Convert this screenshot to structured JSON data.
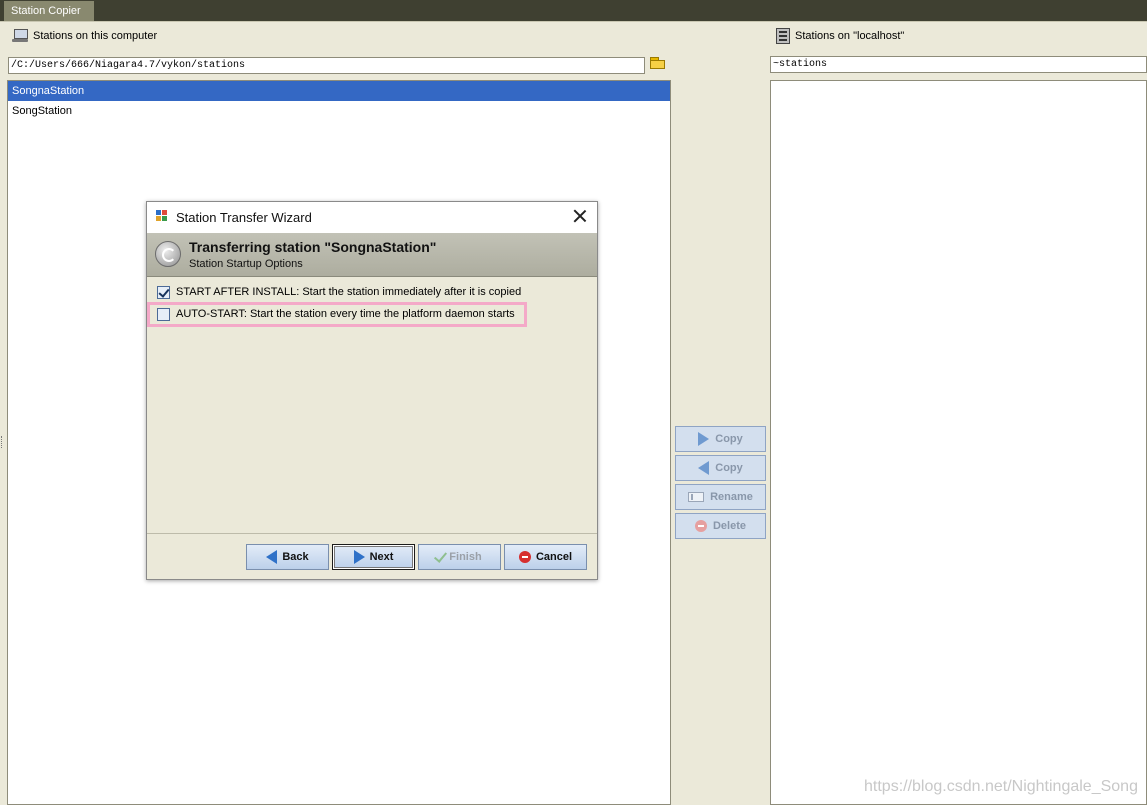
{
  "window": {
    "tab_label": "Station Copier"
  },
  "left_panel": {
    "label": "Stations on this computer",
    "path": "/C:/Users/666/Niagara4.7/vykon/stations",
    "items": [
      {
        "label": "SongnaStation",
        "selected": true
      },
      {
        "label": "SongStation",
        "selected": false
      }
    ]
  },
  "right_panel": {
    "label": "Stations on \"localhost\"",
    "path": "~stations"
  },
  "side_buttons": {
    "copy_right": "Copy",
    "copy_left": "Copy",
    "rename": "Rename",
    "delete": "Delete"
  },
  "dialog": {
    "title": "Station Transfer Wizard",
    "header_title": "Transferring station \"SongnaStation\"",
    "header_subtitle": "Station Startup Options",
    "options": [
      {
        "label": "START AFTER INSTALL: Start the station immediately after it is copied",
        "checked": true
      },
      {
        "label": "AUTO-START: Start the station every time the platform daemon starts",
        "checked": false
      }
    ],
    "buttons": {
      "back": "Back",
      "next": "Next",
      "finish": "Finish",
      "cancel": "Cancel"
    }
  },
  "watermark": "https://blog.csdn.net/Nightingale_Song",
  "colors": {
    "selection": "#3468c4",
    "highlight_border": "#f4a9c8",
    "button_arrow": "#2f71c8",
    "cancel_icon": "#d62f2f"
  }
}
